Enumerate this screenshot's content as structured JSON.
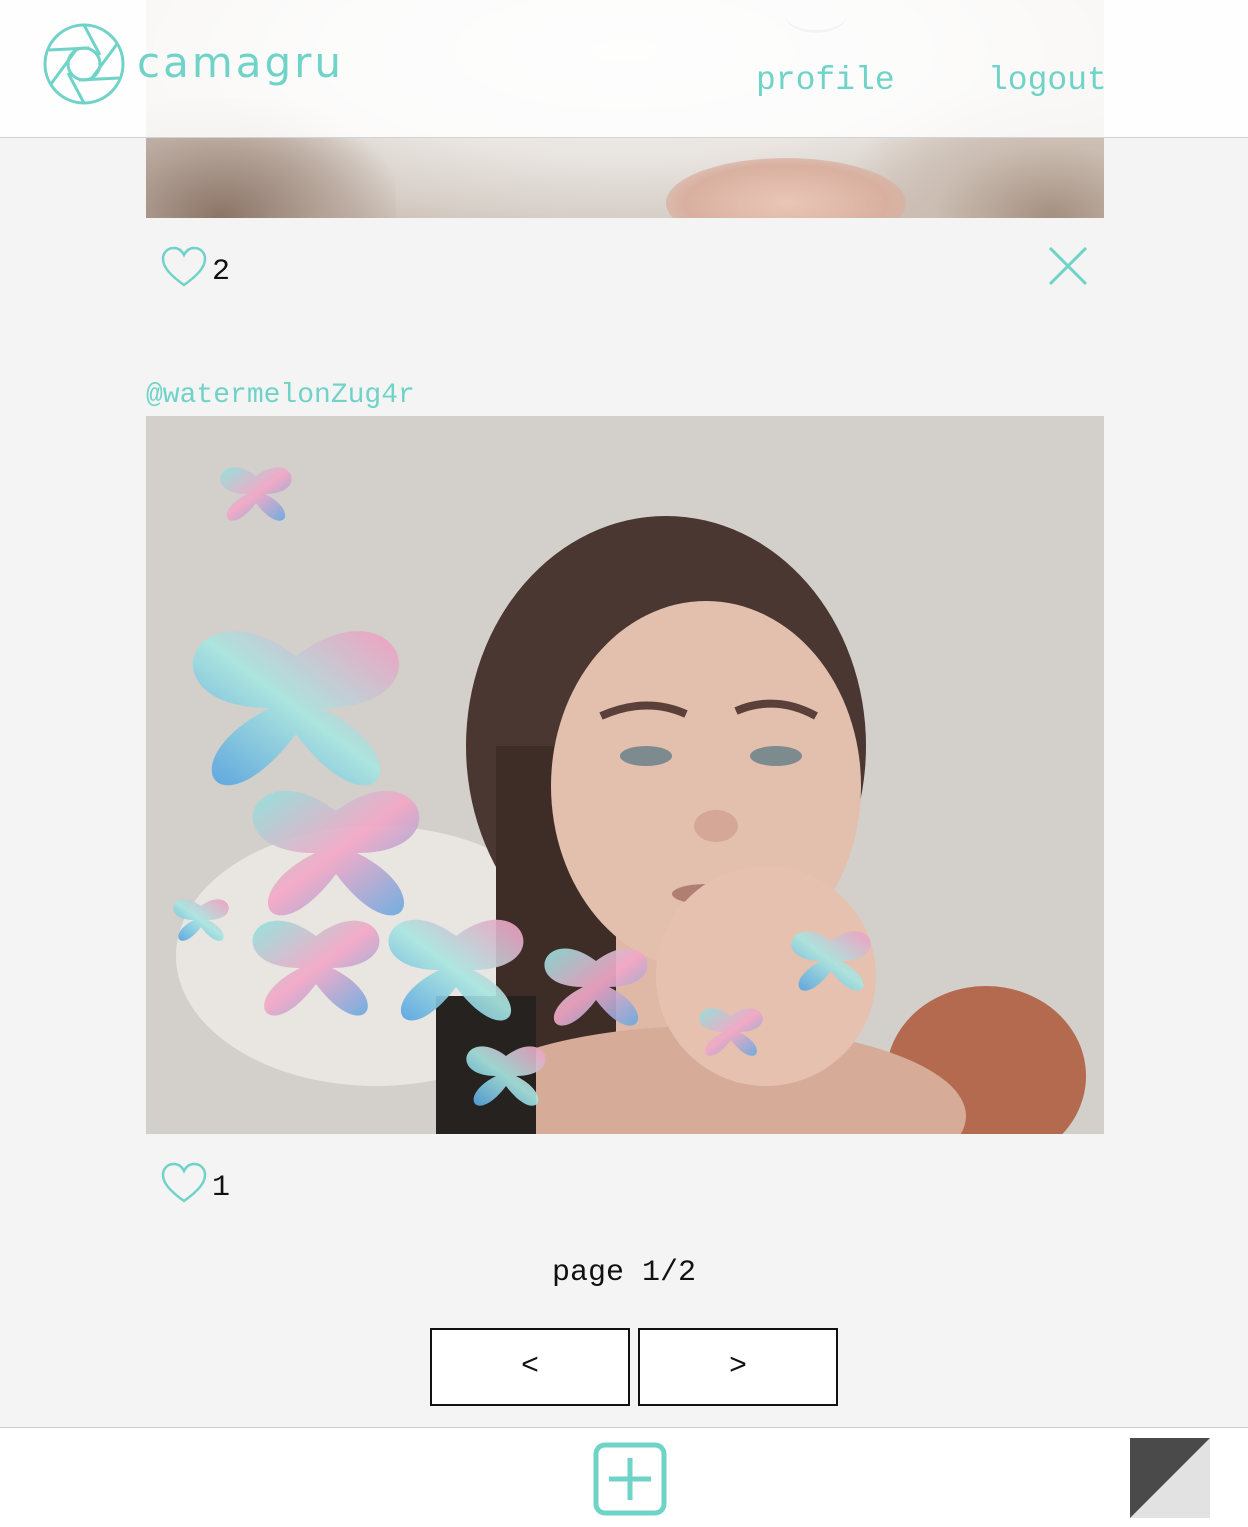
{
  "header": {
    "brand": "camagru",
    "logo_icon": "camera-aperture-icon",
    "nav": {
      "profile": "profile",
      "logout": "logout"
    },
    "accent_color": "#6fd3c8"
  },
  "posts": [
    {
      "likes": "2",
      "like_icon": "heart-outline-icon",
      "delete_icon": "close-icon"
    },
    {
      "username": "@watermelonZug4r",
      "likes": "1",
      "like_icon": "heart-outline-icon"
    }
  ],
  "pagination": {
    "label": "page 1/2",
    "prev": "<",
    "next": ">"
  },
  "footer": {
    "add_icon": "add-square-icon",
    "theme_icon": "theme-toggle-icon"
  }
}
